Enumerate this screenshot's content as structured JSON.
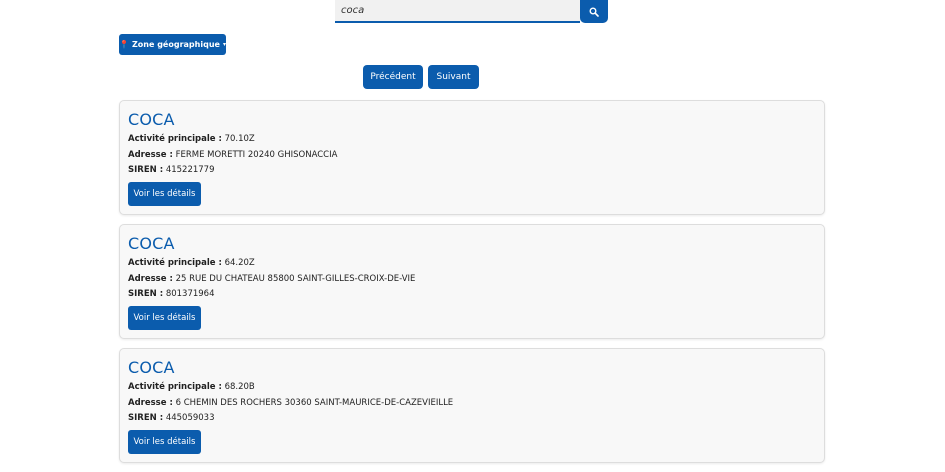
{
  "search": {
    "value": "coca",
    "button_icon": "search-icon"
  },
  "filter": {
    "zone_label": "Zone géographique",
    "zone_icon": "pin-icon",
    "caret": "▾"
  },
  "pagination": {
    "previous_label": "Précédent",
    "next_label": "Suivant"
  },
  "labels": {
    "activity": "Activité principale :",
    "address": "Adresse :",
    "siren": "SIREN :",
    "details_button": "Voir les détails"
  },
  "results": [
    {
      "name": "COCA",
      "activity": "70.10Z",
      "address": "FERME MORETTI 20240 GHISONACCIA",
      "siren": "415221779"
    },
    {
      "name": "COCA",
      "activity": "64.20Z",
      "address": "25 RUE DU CHATEAU 85800 SAINT-GILLES-CROIX-DE-VIE",
      "siren": "801371964"
    },
    {
      "name": "COCA",
      "activity": "68.20B",
      "address": "6 CHEMIN DES ROCHERS 30360 SAINT-MAURICE-DE-CAZEVIEILLE",
      "siren": "445059033"
    }
  ],
  "colors": {
    "accent": "#0b5cad",
    "card_bg": "#f8f8f8"
  }
}
